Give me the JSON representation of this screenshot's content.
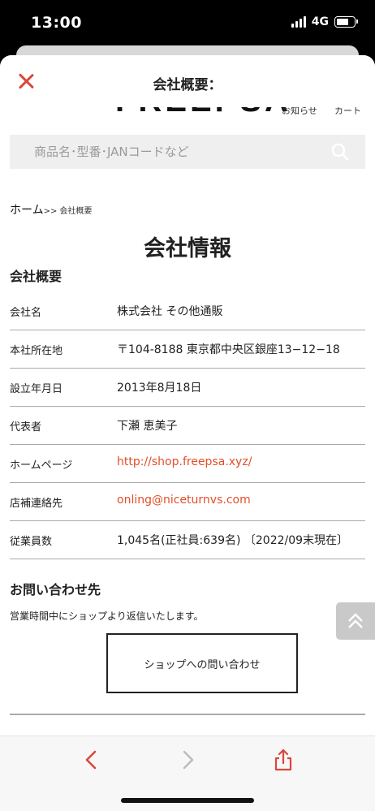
{
  "status_bar": {
    "time": "13:00",
    "network": "4G"
  },
  "sheet": {
    "title": "会社概要："
  },
  "site_header": {
    "logo": "FREEPSA",
    "news_label": "お知らせ",
    "cart_label": "カート"
  },
  "search": {
    "placeholder": "商品名･型番･JANコードなど"
  },
  "breadcrumb": {
    "home": "ホーム",
    "current": ">> 会社概要"
  },
  "page": {
    "title": "会社情報",
    "overview_heading": "会社概要",
    "rows": [
      {
        "key": "会社名",
        "value": "株式会社 その他通販"
      },
      {
        "key": "本社所在地",
        "value": "〒104-8188 東京都中央区銀座13−12−18"
      },
      {
        "key": "設立年月日",
        "value": "2013年8月18日"
      },
      {
        "key": "代表者",
        "value": "下瀬 恵美子"
      },
      {
        "key": "ホームページ",
        "value": "http://shop.freepsa.xyz/"
      },
      {
        "key": "店補連絡先",
        "value": "onling@niceturnvs.com"
      },
      {
        "key": "従業員数",
        "value": "1,045名(正社員:639名) 〔2022/09末現在〕"
      }
    ],
    "contact_heading": "お問い合わせ先",
    "contact_note": "営業時間中にショップより返信いたします。",
    "contact_button": "ショップへの問い合わせ"
  },
  "colors": {
    "accent": "#e24e2a",
    "close": "#d9483b"
  },
  "icons": [
    "close-icon",
    "menu-icon",
    "search-icon",
    "double-chevron-up-icon",
    "back-arrow-icon",
    "forward-arrow-icon",
    "share-icon"
  ]
}
